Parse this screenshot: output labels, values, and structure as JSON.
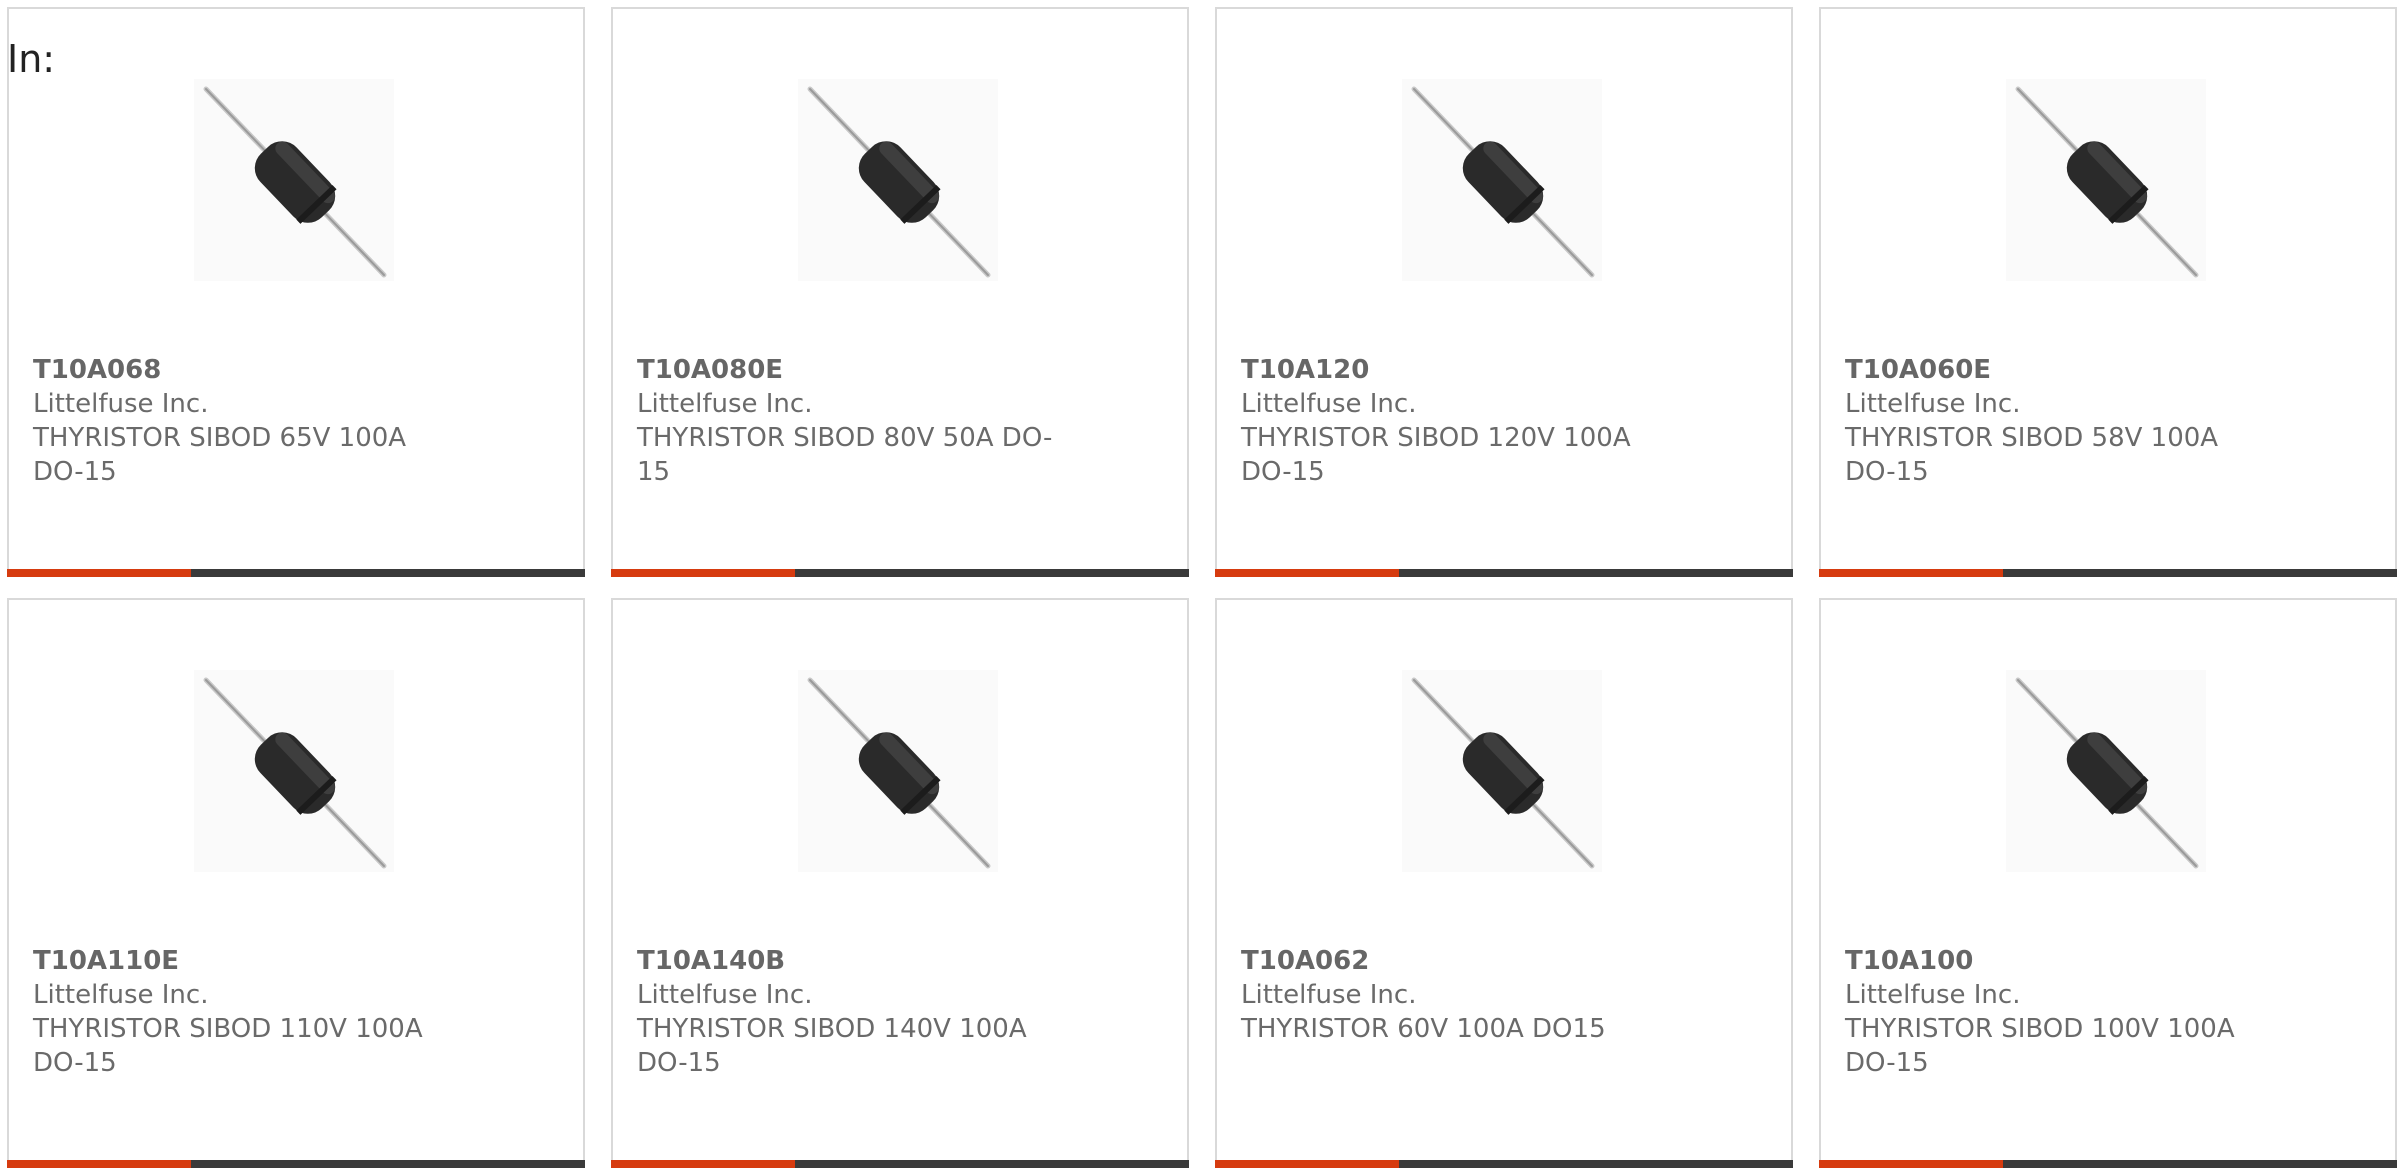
{
  "header": {
    "label": "In:"
  },
  "colors": {
    "accent": "#d63b0f",
    "bar": "#3a3a3a",
    "border": "#d9d9d9",
    "text": "#6a6a6a"
  },
  "products": [
    {
      "part_number": "T10A068",
      "manufacturer": "Littelfuse Inc.",
      "description": "THYRISTOR SIBOD 65V 100A DO-15",
      "image": "axial-diode-do15"
    },
    {
      "part_number": "T10A080E",
      "manufacturer": "Littelfuse Inc.",
      "description": "THYRISTOR SIBOD 80V 50A DO-15",
      "image": "axial-diode-do15"
    },
    {
      "part_number": "T10A120",
      "manufacturer": "Littelfuse Inc.",
      "description": "THYRISTOR SIBOD 120V 100A DO-15",
      "image": "axial-diode-do15"
    },
    {
      "part_number": "T10A060E",
      "manufacturer": "Littelfuse Inc.",
      "description": "THYRISTOR SIBOD 58V 100A DO-15",
      "image": "axial-diode-do15"
    },
    {
      "part_number": "T10A110E",
      "manufacturer": "Littelfuse Inc.",
      "description": "THYRISTOR SIBOD 110V 100A DO-15",
      "image": "axial-diode-do15"
    },
    {
      "part_number": "T10A140B",
      "manufacturer": "Littelfuse Inc.",
      "description": "THYRISTOR SIBOD 140V 100A DO-15",
      "image": "axial-diode-do15"
    },
    {
      "part_number": "T10A062",
      "manufacturer": "Littelfuse Inc.",
      "description": "THYRISTOR 60V 100A DO15",
      "image": "axial-diode-do15"
    },
    {
      "part_number": "T10A100",
      "manufacturer": "Littelfuse Inc.",
      "description": "THYRISTOR SIBOD 100V 100A DO-15",
      "image": "axial-diode-do15"
    }
  ]
}
